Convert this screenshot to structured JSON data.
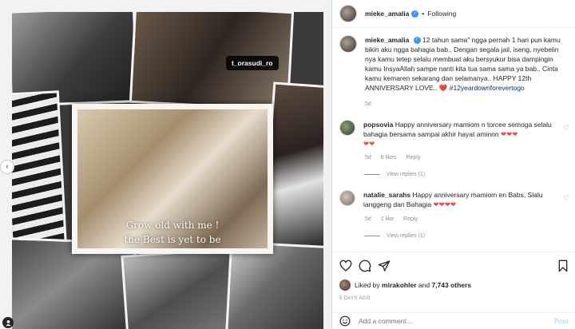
{
  "post": {
    "image_captions": [
      "Grow old with me !",
      "the Best is yet to be"
    ],
    "tagged_user": "t_orasudi_ro"
  },
  "header": {
    "username": "mieke_amalia",
    "dot": "•",
    "follow_label": "Following"
  },
  "caption": {
    "username": "mieke_amalia",
    "text": "12 tahun sama\" ngga pernah 1 hari pun kamu bikin aku ngga bahagia bab.. Dengan segala jail, iseng, nyebelin nya kamu tetep selalu membuat aku bersyukur bisa dampingin kamu InsyaAllah sampe nanti kita tua sama sama ya bab.. Cinta kamu kemaren sekarang dan selamanya.. HAPPY 12th ANNIVERSARY LOVE..",
    "hearts": "❤️",
    "hashtag": "#12yeardownforevertogo",
    "time": "5d"
  },
  "comments": [
    {
      "username": "popsovia",
      "text": "Happy anniversary mamiom n torcee semoga selalu bahagia bersama sampai akhir hayat aminnn",
      "hearts1": "❤❤❤",
      "hearts2": "❤❤",
      "time": "5d",
      "likes": "6 likes",
      "reply": "Reply",
      "view_replies": "View replies (1)"
    },
    {
      "username": "natalie_sarahs",
      "text": "Happy anniversary mamiom en Babs, Slalu langgeng dan Bahagia",
      "hearts": "❤❤❤❤",
      "time": "5d",
      "likes": "1 like",
      "reply": "Reply",
      "view_replies": "View replies (1)"
    }
  ],
  "actions": {
    "liked_by_prefix": "Liked by",
    "liked_by_user": "mirakohler",
    "and": "and",
    "others": "7,743 others",
    "time_ago": "5 DAYS AGO"
  },
  "add_comment": {
    "placeholder": "Add a comment…",
    "post_label": "Post"
  },
  "icons": {
    "like": "heart-outline",
    "comment": "speech-bubble",
    "share": "paper-plane",
    "save": "bookmark",
    "emoji": "smiley"
  },
  "colors": {
    "verified": "#3897f0",
    "heart": "#ed4956",
    "hashtag": "#00376b",
    "muted": "#8e8e8e",
    "post_disabled": "#b2dffc"
  }
}
